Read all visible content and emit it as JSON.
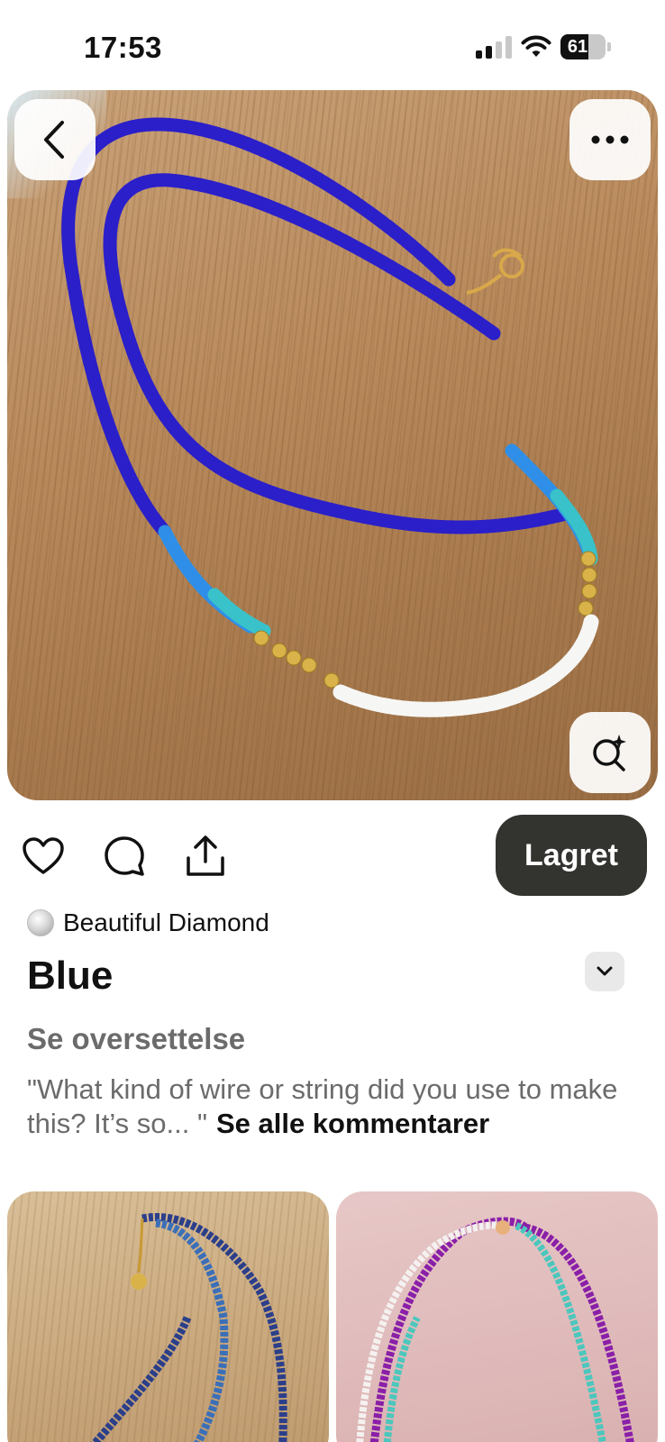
{
  "status_bar": {
    "time": "17:53",
    "battery": "61",
    "battery_level": 0.61
  },
  "icons": {
    "back": "chevron-left-icon",
    "more": "more-horizontal-icon",
    "visual_search": "visual-search-sparkle-icon",
    "like": "heart-icon",
    "comment": "comment-bubble-icon",
    "share": "share-upload-icon",
    "expand": "chevron-down-icon"
  },
  "actions": {
    "saved_label": "Lagret"
  },
  "pin": {
    "author": "Beautiful Diamond",
    "title": "Blue",
    "translate_label": "Se oversettelse",
    "comment_preview": "\"What kind of wire or string did you use to make this? It’s so... \"",
    "see_all_comments": "Se alle kommentarer"
  },
  "colors": {
    "saved_button_bg": "#333330",
    "text_primary": "#111111",
    "text_secondary": "#6b6b6b"
  }
}
